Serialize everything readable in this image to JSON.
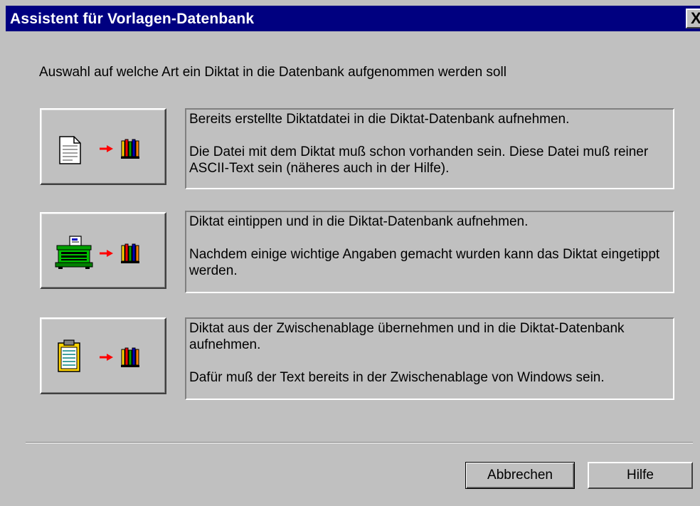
{
  "window": {
    "title": "Assistent für Vorlagen-Datenbank",
    "close_label": "X"
  },
  "intro": "Auswahl auf welche Art ein Diktat in die Datenbank aufgenommen werden soll",
  "options": [
    {
      "icon": "document-file-icon",
      "heading": "Bereits erstellte Diktatdatei in die Diktat-Datenbank aufnehmen.",
      "detail": "Die Datei mit dem Diktat muß schon vorhanden sein. Diese Datei muß reiner ASCII-Text sein (näheres auch in der Hilfe)."
    },
    {
      "icon": "typewriter-icon",
      "heading": "Diktat eintippen und in die Diktat-Datenbank aufnehmen.",
      "detail": "Nachdem einige wichtige Angaben gemacht wurden kann das Diktat eingetippt werden."
    },
    {
      "icon": "clipboard-icon",
      "heading": "Diktat aus der Zwischenablage übernehmen und in die Diktat-Datenbank aufnehmen.",
      "detail": "Dafür muß der Text bereits in der Zwischenablage von Windows sein."
    }
  ],
  "buttons": {
    "cancel": "Abbrechen",
    "help": "Hilfe"
  },
  "colors": {
    "titlebar": "#000080",
    "face": "#c0c0c0",
    "arrow": "#ff0000"
  }
}
